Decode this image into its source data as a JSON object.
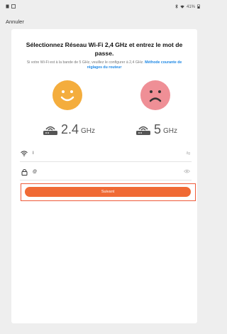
{
  "status_bar": {
    "left_icons": [
      "sim-icon",
      "gallery-icon"
    ],
    "right_text": "41%"
  },
  "header": {
    "cancel_label": "Annuler"
  },
  "main": {
    "title": "Sélectionnez Réseau Wi-Fi 2,4 GHz et entrez le mot de passe.",
    "subtitle_text": "Si votre Wi-Fi est à la bande de 5 GHz, veuillez le configurer à 2,4 GHz.",
    "subtitle_link": "Méthode courante de réglages du routeur",
    "band_24": {
      "big": "2.4",
      "small": "GHz",
      "face": "happy"
    },
    "band_5": {
      "big": "5",
      "small": "GHz",
      "face": "sad"
    },
    "ssid_field": {
      "icon": "wifi-icon",
      "value": "I",
      "right_hint": "ðg"
    },
    "password_field": {
      "icon": "lock-icon",
      "value": "@",
      "right_icon": "eye-icon"
    },
    "next_button_label": "Suivant"
  },
  "colors": {
    "accent": "#f06a35",
    "happy_face": "#f4ad3d",
    "sad_face": "#ef8f96",
    "link": "#1e88e5"
  }
}
